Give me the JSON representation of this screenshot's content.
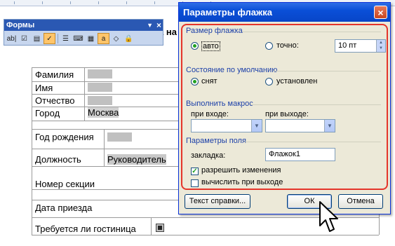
{
  "document": {
    "title_fragment": "а на",
    "rows": [
      {
        "label": "Фамилия",
        "value": ""
      },
      {
        "label": "Имя",
        "value": ""
      },
      {
        "label": "Отчество",
        "value": ""
      },
      {
        "label": "Город",
        "value": "Москва"
      },
      {
        "label": "Год рождения",
        "value": ""
      },
      {
        "label": "Должность",
        "value": "Руководитель"
      },
      {
        "label": "Номер секции",
        "value": ""
      },
      {
        "label": "Дата приезда",
        "value": ""
      },
      {
        "label": "Требуется ли гостиница",
        "value": ""
      }
    ]
  },
  "forms_toolbar": {
    "title": "Формы",
    "close_glyph": "×",
    "menu_glyph": "▼",
    "buttons": [
      "ab|",
      "☑",
      "▤",
      "✓",
      "☰",
      "⌨",
      "▦",
      "a",
      "◇",
      "🔒"
    ]
  },
  "dialog": {
    "title": "Параметры флажка",
    "close_glyph": "×",
    "size_group": "Размер флажка",
    "auto_label": "авто",
    "exact_label": "точно:",
    "size_value": "10 пт",
    "default_group": "Состояние по умолчанию",
    "unchecked_label": "снят",
    "checked_label": "установлен",
    "macro_group": "Выполнить макрос",
    "on_entry_label": "при входе:",
    "on_exit_label": "при выходе:",
    "on_entry_value": "",
    "on_exit_value": "",
    "field_group": "Параметры поля",
    "bookmark_label": "закладка:",
    "bookmark_value": "Флажок1",
    "allow_changes_label": "разрешить изменения",
    "calc_on_exit_label": "вычислить при выходе",
    "help_text_button": "Текст справки...",
    "ok_button": "ОК",
    "cancel_button": "Отмена"
  },
  "colors": {
    "title_bar": "#0a4fd8",
    "highlight_border": "#e5352a",
    "dialog_bg": "#ece9d8"
  }
}
